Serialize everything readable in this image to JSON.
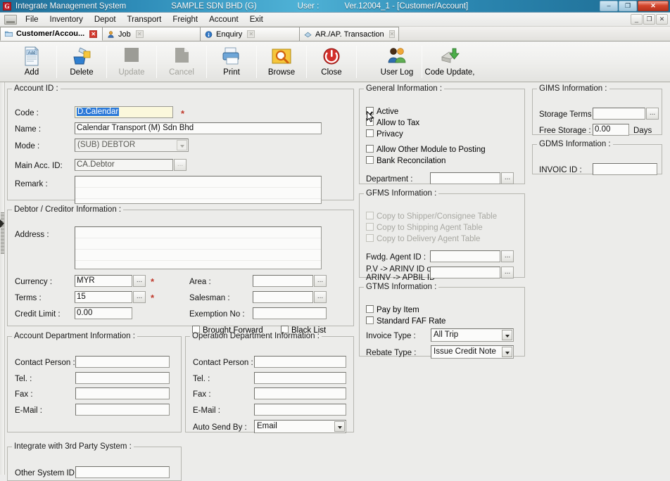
{
  "window": {
    "app_icon": "G",
    "title": "Integrate Management System",
    "company": "SAMPLE SDN BHD (G)",
    "user_label": "User :",
    "version_doc": "Ver.12004_1 - [Customer/Account]",
    "buttons": {
      "minimize": "–",
      "maximize": "❐",
      "close": "✕"
    },
    "mdi_buttons": {
      "minimize": "_",
      "restore": "❐",
      "close": "✕"
    }
  },
  "menu": {
    "system_icon": "system-menu-icon",
    "items": [
      "File",
      "Inventory",
      "Depot",
      "Transport",
      "Freight",
      "Account",
      "Exit"
    ]
  },
  "tabs": [
    {
      "label": "Customer/Accou...",
      "icon": "folder-icon",
      "active": true,
      "close": "✕"
    },
    {
      "label": "Job",
      "icon": "job-icon",
      "active": false,
      "close": "✕"
    },
    {
      "label": "Enquiry",
      "icon": "enquiry-icon",
      "active": false,
      "close": "✕"
    },
    {
      "label": "AR./AP. Transaction",
      "icon": "transaction-icon",
      "active": false,
      "close": "✕"
    }
  ],
  "toolbar": {
    "add": "Add",
    "delete": "Delete",
    "update": "Update",
    "cancel": "Cancel",
    "print": "Print",
    "browse": "Browse",
    "close": "Close",
    "user_log": "User Log",
    "code_update": "Code Update,"
  },
  "account_id": {
    "legend": "Account ID :",
    "code_label": "Code :",
    "code_value": "D.Calendar",
    "code_required": "*",
    "name_label": "Name :",
    "name_value": "Calendar Transport (M) Sdn Bhd",
    "mode_label": "Mode :",
    "mode_value": "(SUB) DEBTOR",
    "main_acc_label": "Main Acc. ID:",
    "main_acc_value": "CA.Debtor",
    "main_acc_browse": "...",
    "remark_label": "Remark :",
    "remark_value": ""
  },
  "debtor": {
    "legend": "Debtor / Creditor Information :",
    "address_label": "Address :",
    "address_value": "",
    "currency_label": "Currency :",
    "currency_value": "MYR",
    "currency_browse": "...",
    "currency_required": "*",
    "terms_label": "Terms :",
    "terms_value": "15",
    "terms_browse": "...",
    "terms_required": "*",
    "credit_limit_label": "Credit Limit :",
    "credit_limit_value": "0.00",
    "area_label": "Area :",
    "area_value": "",
    "area_browse": "...",
    "salesman_label": "Salesman :",
    "salesman_value": "",
    "salesman_browse": "...",
    "exemption_label": "Exemption No :",
    "exemption_value": "",
    "brought_forward": "Brought Forward",
    "black_list": "Black List"
  },
  "account_dept": {
    "legend": "Account Department Information :",
    "contact_label": "Contact Person :",
    "contact_value": "",
    "tel_label": "Tel. :",
    "tel_value": "",
    "fax_label": "Fax :",
    "fax_value": "",
    "email_label": "E-Mail :",
    "email_value": ""
  },
  "operation_dept": {
    "legend": "Operation Department Information :",
    "contact_label": "Contact Person :",
    "contact_value": "",
    "tel_label": "Tel. :",
    "tel_value": "",
    "fax_label": "Fax :",
    "fax_value": "",
    "email_label": "E-Mail :",
    "email_value": "",
    "auto_send_label": "Auto Send By :",
    "auto_send_value": "Email"
  },
  "third_party": {
    "legend": "Integrate with 3rd Party System :",
    "other_system_label": "Other System ID :",
    "other_system_value": ""
  },
  "general": {
    "legend": "General Information :",
    "active": "Active",
    "active_checked": true,
    "allow_to_tax": "Allow to Tax",
    "privacy": "Privacy",
    "allow_other_module": "Allow Other Module to Posting",
    "bank_reconcilation": "Bank Reconcilation",
    "department_label": "Department :",
    "department_value": "",
    "department_browse": "..."
  },
  "gfms": {
    "legend": "GFMS Information :",
    "copy_shipper": "Copy to Shipper/Consignee Table",
    "copy_shipping_agent": "Copy to Shipping Agent Table",
    "copy_delivery_agent": "Copy to Delivery Agent Table",
    "fwdg_agent_label": "Fwdg. Agent ID :",
    "fwdg_agent_value": "",
    "fwdg_agent_browse": "...",
    "pv_arinv_label_1": "P.V -> ARINV ID or",
    "pv_arinv_label_2": "ARINV -> APBIL ID",
    "pv_arinv_value": "",
    "pv_arinv_browse": "..."
  },
  "gtms": {
    "legend": "GTMS Information :",
    "pay_by_item": "Pay by Item",
    "standard_faf_rate": "Standard FAF Rate",
    "invoice_type_label": "Invoice Type :",
    "invoice_type_value": "All Trip",
    "rebate_type_label": "Rebate Type :",
    "rebate_type_value": "Issue Credit Note"
  },
  "gims": {
    "legend": "GIMS Information :",
    "storage_terms_label": "Storage Terms :",
    "storage_terms_value": "",
    "storage_terms_browse": "...",
    "free_storage_label": "Free Storage :",
    "free_storage_value": "0.00",
    "days_label": "Days"
  },
  "gdms": {
    "legend": "GDMS Information :",
    "invoic_id_label": "INVOIC ID :",
    "invoic_id_value": ""
  },
  "colors": {
    "title_bar": "#2b86b0",
    "app_icon_red": "#c0202a",
    "required_star": "#c0392b",
    "selection_blue": "#2a78d8",
    "focus_field_yellow": "#fbf8dc",
    "form_bg": "#ececea"
  }
}
